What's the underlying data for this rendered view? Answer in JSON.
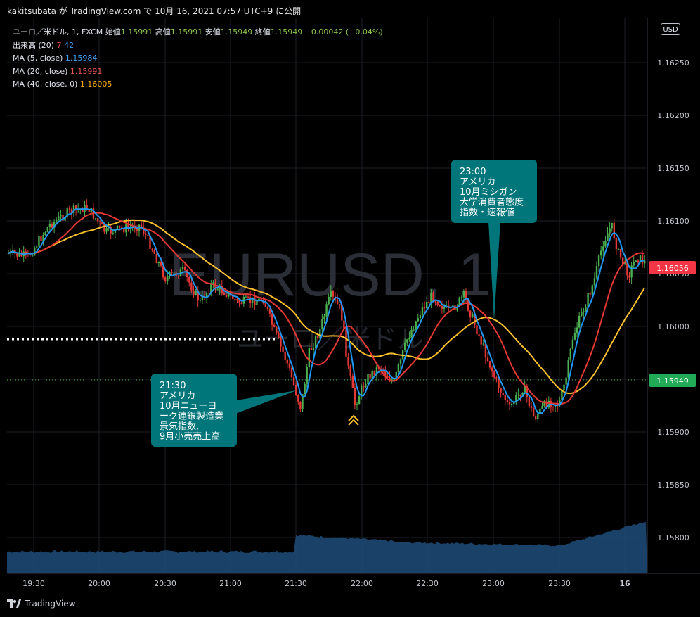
{
  "header": {
    "text": "kakitsubata が TradingView.com で 10月 16, 2021 07:57 UTC+9 に公開"
  },
  "legend": {
    "symbol": "ユーロ／米ドル, 1, FXCM",
    "open_label": "始値",
    "open": "1.15991",
    "high_label": "高値",
    "high": "1.15991",
    "low_label": "安値",
    "low": "1.15949",
    "close_label": "終値",
    "close": "1.15949",
    "change": "−0.00042 (−0.04%)",
    "volume_label": "出来高 (20)",
    "volume_a": "7",
    "volume_b": "42",
    "ma5_label": "MA (5, close)",
    "ma5_value": "1.15984",
    "ma20_label": "MA (20, close)",
    "ma20_value": "1.15991",
    "ma40_label": "MA (40, close, 0)",
    "ma40_value": "1.16005"
  },
  "currency_button": "USD",
  "price_axis": [
    "1.16250",
    "1.16200",
    "1.16150",
    "1.16100",
    "1.16050",
    "1.16000",
    "1.15950",
    "1.15900",
    "1.15850",
    "1.15800"
  ],
  "time_axis": [
    "19:30",
    "20:00",
    "20:30",
    "21:00",
    "21:30",
    "22:00",
    "22:30",
    "23:00",
    "23:30",
    "16"
  ],
  "price_tags": {
    "last_ma": "1.16056",
    "current": "1.15949"
  },
  "watermark": {
    "symbol": "EURUSD, 1",
    "description": "ユーロ／米ドル"
  },
  "callouts": {
    "event1": {
      "lines": [
        "21:30",
        "アメリカ",
        "10月ニューヨ",
        "ーク連銀製造業",
        "景気指数,",
        "9月小売売上高"
      ]
    },
    "event2": {
      "lines": [
        "23:00",
        "アメリカ",
        "10月ミシガン",
        "大学消費者態度",
        "指数・速報値"
      ]
    }
  },
  "colors": {
    "up": "#4caf50",
    "down": "#e53935",
    "ma5": "#2196f3",
    "ma20": "#e53935",
    "ma40": "#fbc02d",
    "callout_bg": "#00757a",
    "volume": "#1e4e7a",
    "tag_red": "#f23645",
    "tag_green": "#22ab57"
  },
  "footer": {
    "brand": "TradingView"
  }
}
